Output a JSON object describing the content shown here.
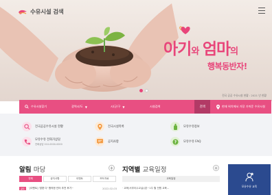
{
  "header": {
    "logo_text": "수유시설 검색",
    "menu_icon": "hamburger-icon"
  },
  "hero": {
    "title_part1": "아기",
    "title_conj1": "와 ",
    "title_part2": "엄마",
    "title_conj2": "의",
    "subtitle": "행복동반자!",
    "caption": "전국 공공 수유시설 현황 : 2021 년 현황",
    "slide_count": 2,
    "active_slide": 1,
    "accent_color": "#e8457a"
  },
  "search": {
    "field1": "수유시설찾기",
    "field2": "광역시/도",
    "field3": "시/군/구",
    "field4": "시설검색",
    "search_label": "검색",
    "region_label": "현재 위치에서 가장 가까운 수유시설"
  },
  "quick_links": [
    {
      "label": "전국공공수유시설 현황",
      "sub": "",
      "icon": "map-check-icon",
      "color": "#e84f82"
    },
    {
      "label": "전국시설목록",
      "sub": "",
      "icon": "location-pin-icon",
      "color": "#f39c45"
    },
    {
      "label": "모유수유정보",
      "sub": "",
      "icon": "baby-bottle-icon",
      "color": "#6cb33f"
    },
    {
      "label": "모유수유 전화가상담",
      "sub": "전화상담 010-0000-0000",
      "icon": "phone-consult-icon",
      "color": "#e84f82"
    },
    {
      "label": "공지사항",
      "sub": "",
      "icon": "notice-icon",
      "color": "#f39c45"
    },
    {
      "label": "모유수유 FAQ",
      "sub": "",
      "icon": "faq-icon",
      "color": "#6cb33f"
    }
  ],
  "notice": {
    "title_bold": "알림",
    "title_light": "마당",
    "plus": "+",
    "tabs": [
      "전체",
      "공지사항",
      "이벤트",
      "보도자료"
    ],
    "active_tab": 0,
    "row_badge": "공지",
    "row_text": "· [이벤트] '맘편 다' 함의한 인터 추천 후기~",
    "row_date": "2022-02-03"
  },
  "region_schedule": {
    "title_bold": "지역별",
    "title_light": "교육일정",
    "plus": "+",
    "box_label": "교육일정",
    "row_text": "· 교육(서부이수교실)(본~1주 월 전원 교육..."
  },
  "edu_card": {
    "label": "모유수유 교육",
    "icon": "education-icon"
  }
}
